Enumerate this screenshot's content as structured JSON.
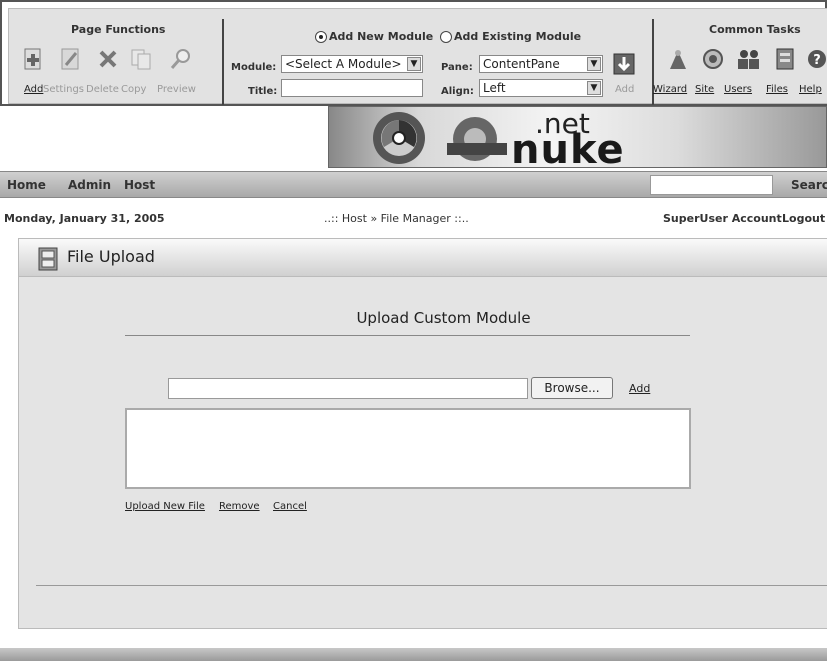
{
  "control_panel": {
    "page_functions_header": "Page Functions",
    "page_functions": [
      {
        "label": "Add",
        "icon": "add-page-icon",
        "enabled": true
      },
      {
        "label": "Settings",
        "icon": "settings-icon",
        "enabled": false
      },
      {
        "label": "Delete",
        "icon": "delete-icon",
        "enabled": false
      },
      {
        "label": "Copy",
        "icon": "copy-icon",
        "enabled": false
      },
      {
        "label": "Preview",
        "icon": "preview-icon",
        "enabled": false
      }
    ],
    "mode_options": {
      "add_new": "Add New Module",
      "add_existing": "Add Existing Module",
      "selected": "add_new"
    },
    "module_label": "Module:",
    "module_value": "<Select A Module>",
    "title_label": "Title:",
    "title_value": "",
    "pane_label": "Pane:",
    "pane_value": "ContentPane",
    "align_label": "Align:",
    "align_value": "Left",
    "add_button_label": "Add",
    "common_tasks_header": "Common Tasks",
    "common_tasks": [
      {
        "label": "Wizard",
        "icon": "wizard-icon"
      },
      {
        "label": "Site",
        "icon": "site-icon"
      },
      {
        "label": "Users",
        "icon": "users-icon"
      },
      {
        "label": "Files",
        "icon": "files-icon"
      },
      {
        "label": "Help",
        "icon": "help-icon"
      }
    ]
  },
  "banner": {
    "logo_top": ".net",
    "logo_bottom": "nuke"
  },
  "nav": {
    "items": [
      "Home",
      "Admin",
      "Host"
    ],
    "search_value": "",
    "search_label": "Search"
  },
  "info_bar": {
    "date": "Monday, January 31, 2005",
    "breadcrumb": "..:: Host » File Manager ::..",
    "account": "SuperUser Account",
    "logout": "Logout"
  },
  "module": {
    "title": "File Upload",
    "panel_title": "Upload Custom Module",
    "file_path_value": "",
    "browse_label": "Browse...",
    "add_label": "Add",
    "actions": [
      "Upload New File",
      "Remove",
      "Cancel"
    ]
  },
  "colors": {
    "control_panel_bg": "#e2e2e2",
    "nav_bg": "#b8b8b8",
    "module_bg": "#e4e4e4"
  }
}
